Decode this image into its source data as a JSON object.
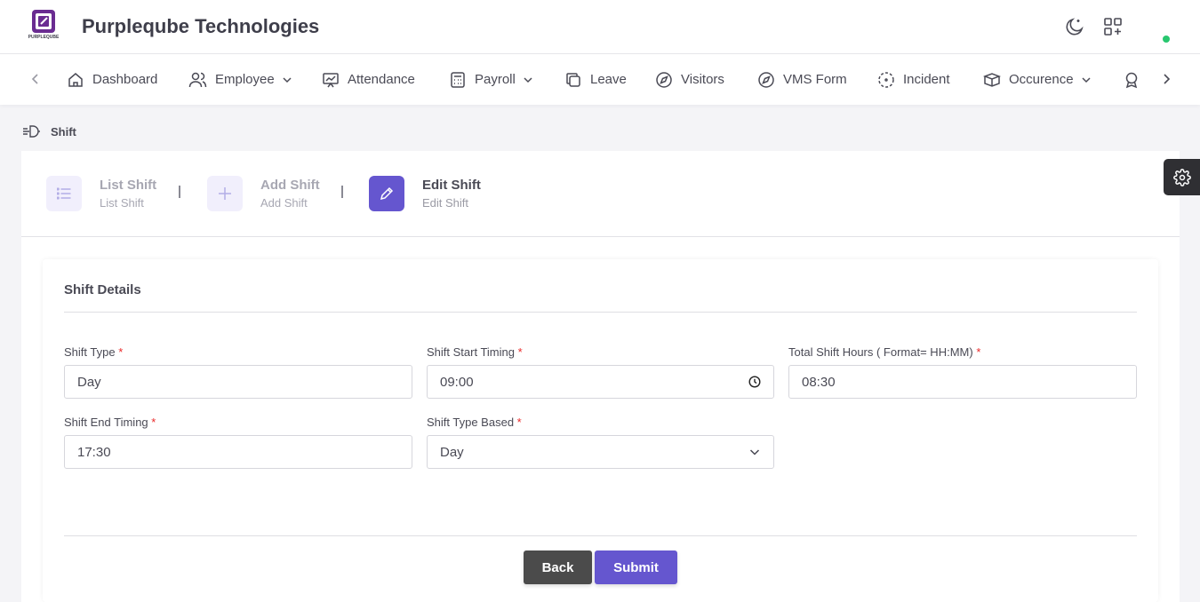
{
  "app": {
    "company_name": "Purpleqube Technologies",
    "logo_text": "PURPLEQUBE"
  },
  "nav": {
    "items": [
      {
        "label": "Dashboard",
        "icon": "home-icon",
        "has_dropdown": false
      },
      {
        "label": "Employee",
        "icon": "users-icon",
        "has_dropdown": true
      },
      {
        "label": "Attendance",
        "icon": "presentation-chart-icon",
        "has_dropdown": false
      },
      {
        "label": "Payroll",
        "icon": "calculator-icon",
        "has_dropdown": true
      },
      {
        "label": "Leave",
        "icon": "copy-icon",
        "has_dropdown": false
      },
      {
        "label": "Visitors",
        "icon": "compass-icon",
        "has_dropdown": false
      },
      {
        "label": "VMS Form",
        "icon": "compass-icon",
        "has_dropdown": false
      },
      {
        "label": "Incident",
        "icon": "focus-icon",
        "has_dropdown": false
      },
      {
        "label": "Occurence",
        "icon": "box-icon",
        "has_dropdown": true
      }
    ]
  },
  "breadcrumb": {
    "label": "Shift",
    "icon": "shift-icon"
  },
  "steps": [
    {
      "title": "List Shift",
      "subtitle": "List Shift",
      "icon": "list-icon",
      "active": false
    },
    {
      "title": "Add Shift",
      "subtitle": "Add Shift",
      "icon": "plus-icon",
      "active": false
    },
    {
      "title": "Edit Shift",
      "subtitle": "Edit Shift",
      "icon": "pencil-icon",
      "active": true
    }
  ],
  "form": {
    "title": "Shift Details",
    "fields": {
      "shift_type": {
        "label": "Shift Type",
        "value": "Day"
      },
      "shift_start": {
        "label": "Shift Start Timing",
        "value": "09:00"
      },
      "total_hours": {
        "label": "Total Shift Hours ( Format= HH:MM)",
        "value": "08:30"
      },
      "shift_end": {
        "label": "Shift End Timing",
        "value": "17:30"
      },
      "shift_type_based": {
        "label": "Shift Type Based",
        "value": "Day"
      }
    },
    "required_mark": "*",
    "back_label": "Back",
    "submit_label": "Submit"
  },
  "colors": {
    "accent": "#6556cf",
    "back_button": "#4b4b4b",
    "required": "#ea2a2a",
    "online": "#28c76f"
  }
}
